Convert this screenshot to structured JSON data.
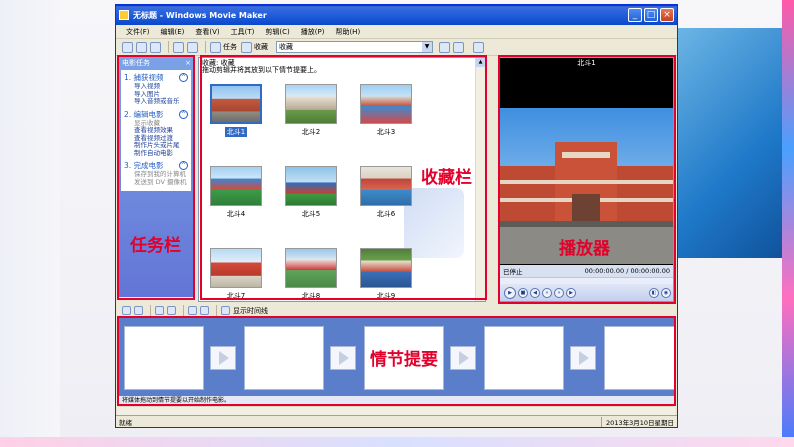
{
  "window": {
    "title": "无标题 - Windows Movie Maker",
    "controls": [
      "_",
      "□",
      "×"
    ]
  },
  "menu": [
    "文件(F)",
    "编辑(E)",
    "查看(V)",
    "工具(T)",
    "剪辑(C)",
    "播放(P)",
    "帮助(H)"
  ],
  "toolbar": {
    "tasks_label": "任务",
    "collections_label": "收藏",
    "collection_select": "收藏"
  },
  "task_pane": {
    "header": "电影任务",
    "close": "×",
    "sections": [
      {
        "title": "1. 捕获视频",
        "items": [
          "导入视频",
          "导入图片",
          "导入音频或音乐"
        ],
        "dim": false
      },
      {
        "title": "2. 编辑电影",
        "items": [
          "显示收藏",
          "查看视频效果",
          "查看视频过渡",
          "制作片头或片尾",
          "制作自动电影"
        ],
        "dim": false
      },
      {
        "title": "3. 完成电影",
        "items": [
          "保存到我的计算机",
          "发送到 DV 摄像机"
        ],
        "dim": true
      }
    ]
  },
  "collections": {
    "heading": "收藏: 收藏",
    "instruction": "拖动剪辑并将其放到以下情节提要上。",
    "thumbnails": [
      "北斗1",
      "北斗2",
      "北斗3",
      "北斗4",
      "北斗5",
      "北斗6",
      "北斗7",
      "北斗8",
      "北斗9"
    ]
  },
  "player": {
    "title": "北斗1",
    "status": "已停止",
    "time": "00:00:00.00 / 00:00:00.00"
  },
  "storyboard": {
    "toolbar_label": "显示时间线",
    "hint": "将媒体拖动到情节提要以开始制作电影。"
  },
  "statusbar": {
    "left": "就绪",
    "date": "2013年3月10日星期日"
  },
  "annotations": {
    "tasks": "任务栏",
    "collections": "收藏栏",
    "player": "播放器",
    "storyboard": "情节提要"
  },
  "colors": {
    "annotation": "#e3002b",
    "title_bar": "#1c5ad9",
    "storyboard_bg": "#5b7ecb"
  }
}
